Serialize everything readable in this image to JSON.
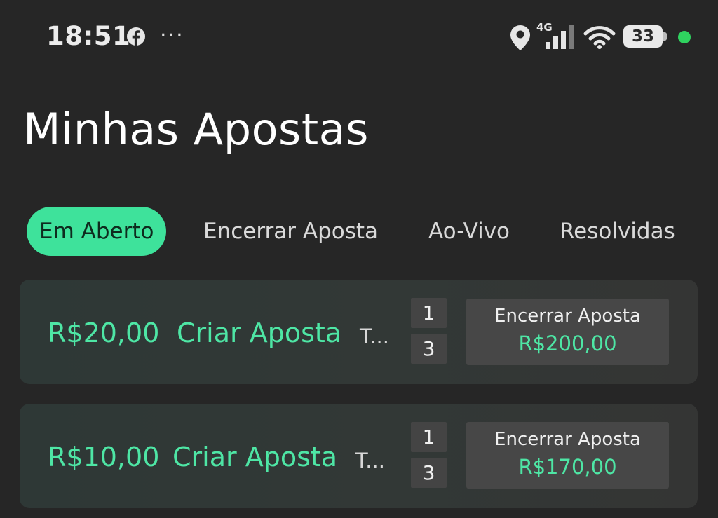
{
  "status_bar": {
    "time": "18:51",
    "more": "···",
    "network": "4G",
    "battery": "33",
    "icons": [
      "facebook-icon",
      "location-icon",
      "signal-icon",
      "wifi-icon",
      "battery-icon"
    ],
    "colors": {
      "notification_dot": "#2fd25f"
    }
  },
  "page": {
    "title": "Minhas Apostas"
  },
  "tabs": [
    {
      "label": "Em Aberto",
      "active": true
    },
    {
      "label": "Encerrar Aposta",
      "active": false
    },
    {
      "label": "Ao-Vivo",
      "active": false
    },
    {
      "label": "Resolvidas",
      "active": false
    }
  ],
  "bets": [
    {
      "amount": "R$20,00",
      "action": "Criar Aposta",
      "team": "T...",
      "score_top": "1",
      "score_bottom": "3",
      "cashout_label": "Encerrar Aposta",
      "cashout_value": "R$200,00"
    },
    {
      "amount": "R$10,00",
      "action": "Criar Aposta",
      "team": "T...",
      "score_top": "1",
      "score_bottom": "3",
      "cashout_label": "Encerrar Aposta",
      "cashout_value": "R$170,00"
    }
  ],
  "colors": {
    "accent": "#3ee29b",
    "accent_text": "#4ee6a5",
    "background": "#262626"
  }
}
